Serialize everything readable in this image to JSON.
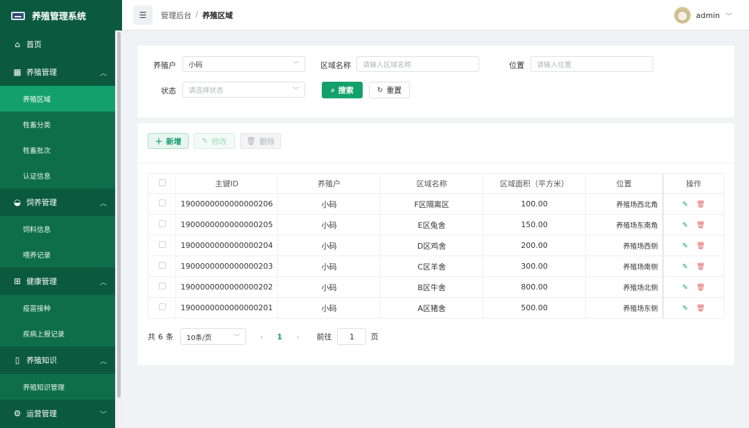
{
  "app": {
    "title": "养殖管理系统"
  },
  "sidebar": {
    "home": "首页",
    "groups": [
      {
        "label": "养殖管理",
        "icon": "grid-icon",
        "items": [
          "养殖区域",
          "牲畜分类",
          "牲畜批次",
          "认证信息"
        ]
      },
      {
        "label": "饲养管理",
        "icon": "bowl-icon",
        "items": [
          "饲料信息",
          "喂养记录"
        ]
      },
      {
        "label": "健康管理",
        "icon": "medical-kit-icon",
        "items": [
          "疫苗接种",
          "疾病上报记录"
        ]
      },
      {
        "label": "养殖知识",
        "icon": "book-icon",
        "items": [
          "养殖知识管理"
        ]
      },
      {
        "label": "运营管理",
        "icon": "gear-icon",
        "items": []
      }
    ],
    "active_item": "养殖区域"
  },
  "header": {
    "breadcrumb": [
      "管理后台",
      "养殖区域"
    ],
    "user": "admin"
  },
  "filters": {
    "farmer_label": "养殖户",
    "farmer_value": "小码",
    "area_name_label": "区域名称",
    "area_name_placeholder": "请输入区域名称",
    "location_label": "位置",
    "location_placeholder": "请输入位置",
    "status_label": "状态",
    "status_placeholder": "请选择状态",
    "search_button": "搜索",
    "reset_button": "重置"
  },
  "toolbar": {
    "add": "新增",
    "edit": "修改",
    "delete": "删除"
  },
  "table": {
    "columns": [
      "主键ID",
      "养殖户",
      "区域名称",
      "区域面积（平方米）",
      "位置",
      "操作"
    ],
    "rows": [
      {
        "id": "1900000000000000206",
        "farmer": "小码",
        "name": "F区隔离区",
        "area": "100.00",
        "location": "养殖场西北角"
      },
      {
        "id": "1900000000000000205",
        "farmer": "小码",
        "name": "E区兔舍",
        "area": "150.00",
        "location": "养殖场东南角"
      },
      {
        "id": "1900000000000000204",
        "farmer": "小码",
        "name": "D区鸡舍",
        "area": "200.00",
        "location": "养殖场西侧"
      },
      {
        "id": "1900000000000000203",
        "farmer": "小码",
        "name": "C区羊舍",
        "area": "300.00",
        "location": "养殖场南侧"
      },
      {
        "id": "1900000000000000202",
        "farmer": "小码",
        "name": "B区牛舍",
        "area": "800.00",
        "location": "养殖场北侧"
      },
      {
        "id": "1900000000000000201",
        "farmer": "小码",
        "name": "A区猪舍",
        "area": "500.00",
        "location": "养殖场东侧"
      }
    ]
  },
  "pagination": {
    "total_prefix": "共",
    "total": "6",
    "total_suffix": "条",
    "page_size": "10条/页",
    "current_page": "1",
    "goto_label": "前往",
    "goto_value": "1",
    "goto_unit": "页"
  },
  "colors": {
    "primary": "#14a06c",
    "sidebar": "#0b5a3f",
    "submenu": "#0e6e4c",
    "danger": "#e26060"
  }
}
